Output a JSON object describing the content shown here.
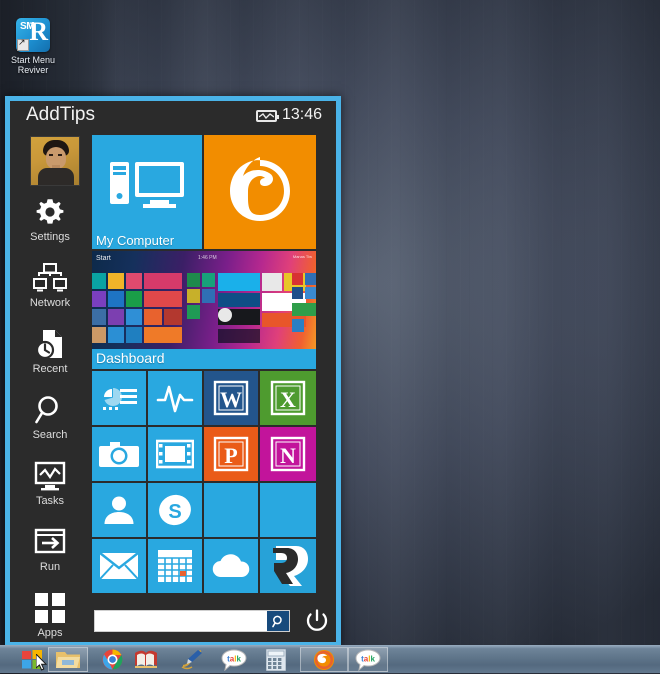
{
  "desktop": {
    "icon": {
      "name": "start-menu-reviver",
      "label": "Start Menu\nReviver",
      "label_line1": "Start Menu",
      "label_line2": "Reviver",
      "badge_text": "SM",
      "logo_letter": "R"
    },
    "wallpaper_color": "#444c5e"
  },
  "startmenu": {
    "title": "AddTips",
    "clock": "13:46",
    "battery_icon": "battery-icon",
    "border_color": "#4ab3e8",
    "background_color": "#2b2b2b",
    "avatar": {
      "name": "user-avatar"
    },
    "sidebar": [
      {
        "label": "Settings",
        "icon": "gear-icon"
      },
      {
        "label": "Network",
        "icon": "network-icon"
      },
      {
        "label": "Recent",
        "icon": "recent-document-clock-icon"
      },
      {
        "label": "Search",
        "icon": "magnifier-icon"
      },
      {
        "label": "Tasks",
        "icon": "task-manager-monitor-icon"
      },
      {
        "label": "Run",
        "icon": "run-arrow-icon"
      },
      {
        "label": "Apps",
        "icon": "apps-grid-icon"
      }
    ],
    "tiles": [
      {
        "id": "my-computer",
        "label": "My Computer",
        "icon": "computer-icon",
        "color": "#29a8e0"
      },
      {
        "id": "firefox",
        "label": "",
        "icon": "firefox-icon",
        "color": "#f28d00"
      },
      {
        "id": "dashboard",
        "label": "Dashboard",
        "icon": "dashboard-preview",
        "color": "#29a8e0"
      },
      {
        "id": "task-manager",
        "label": "",
        "icon": "task-manager-icon",
        "color": "#29a8e0"
      },
      {
        "id": "health",
        "label": "",
        "icon": "pulse-icon",
        "color": "#29a8e0"
      },
      {
        "id": "word",
        "label": "W",
        "icon": "word-icon",
        "color": "#23558c"
      },
      {
        "id": "excel",
        "label": "X",
        "icon": "excel-icon",
        "color": "#4e9b2f"
      },
      {
        "id": "camera",
        "label": "",
        "icon": "camera-icon",
        "color": "#29a8e0"
      },
      {
        "id": "video",
        "label": "",
        "icon": "film-icon",
        "color": "#29a8e0"
      },
      {
        "id": "powerpoint",
        "label": "P",
        "icon": "powerpoint-icon",
        "color": "#ea5b18"
      },
      {
        "id": "onenote",
        "label": "N",
        "icon": "onenote-icon",
        "color": "#c2149b"
      },
      {
        "id": "people",
        "label": "",
        "icon": "person-icon",
        "color": "#29a8e0"
      },
      {
        "id": "skype",
        "label": "",
        "icon": "skype-icon",
        "color": "#29a8e0"
      },
      {
        "id": "empty-1",
        "label": "",
        "icon": "",
        "color": "#29a8e0"
      },
      {
        "id": "empty-2",
        "label": "",
        "icon": "",
        "color": "#29a8e0"
      },
      {
        "id": "mail",
        "label": "",
        "icon": "envelope-icon",
        "color": "#29a8e0"
      },
      {
        "id": "calendar",
        "label": "",
        "icon": "calendar-icon",
        "color": "#29a8e0"
      },
      {
        "id": "onedrive",
        "label": "",
        "icon": "cloud-icon",
        "color": "#29a8e0"
      },
      {
        "id": "reviver",
        "label": "",
        "icon": "reviver-r-icon",
        "color": "#27a2d8"
      }
    ],
    "dashboard_preview": {
      "start_label": "Start",
      "clock_label": "1:46 PM",
      "user_label": "Manas Tiw"
    },
    "search": {
      "value": "",
      "placeholder": "",
      "button_icon": "search-icon"
    },
    "power": {
      "icon": "power-icon",
      "label": ""
    }
  },
  "taskbar": {
    "items": [
      {
        "name": "start-button",
        "icon": "windows-logo-icon",
        "framed": false
      },
      {
        "name": "file-explorer",
        "icon": "folder-icon",
        "framed": true
      },
      {
        "name": "google-chrome",
        "icon": "chrome-icon",
        "framed": false
      },
      {
        "name": "dictionary",
        "icon": "book-icon",
        "framed": false
      },
      {
        "name": "pen-tool",
        "icon": "pen-icon",
        "framed": false
      },
      {
        "name": "google-talk",
        "icon": "talk-icon",
        "framed": false
      },
      {
        "name": "calculator",
        "icon": "calculator-icon",
        "framed": false
      },
      {
        "name": "mozilla-firefox",
        "icon": "firefox-icon",
        "framed": true
      },
      {
        "name": "google-talk-window",
        "icon": "talk-icon",
        "framed": true
      }
    ]
  }
}
